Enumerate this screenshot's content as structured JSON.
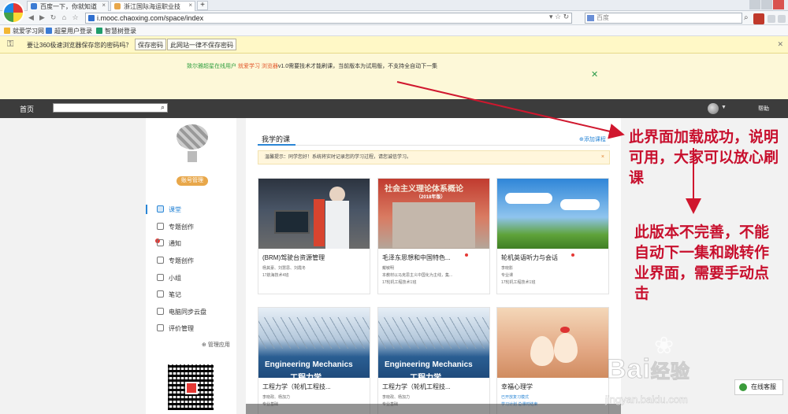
{
  "browser": {
    "tabs": [
      {
        "label": "百度一下，你就知道"
      },
      {
        "label": "浙江国际海运职业技"
      }
    ],
    "url": "i.mooc.chaoxing.com/space/index",
    "search_placeholder": "百度"
  },
  "bookmarks": [
    "就爱学习网",
    "超星用户登录",
    "智慧树登录"
  ],
  "password_bar": {
    "question": "要让360极速浏览器保存您的密码吗？",
    "save_label": "保存密码",
    "never_label": "此网站一律不保存密码"
  },
  "notice": {
    "part1": "致尔雅超星在线用户",
    "part2": "就爱学习 浏览器",
    "part3": "v1.0需要技术才能刷课，当前版本为试用版，不支持全自动下一集"
  },
  "site_header": {
    "home_label": "首页",
    "help_label": "帮助"
  },
  "sidebar": {
    "manage_label": "账号管理",
    "items": [
      {
        "label": "课堂"
      },
      {
        "label": "专题创作"
      },
      {
        "label": "通知"
      },
      {
        "label": "专题创作"
      },
      {
        "label": "小组"
      },
      {
        "label": "笔记"
      },
      {
        "label": "电脑同步云盘"
      },
      {
        "label": "评价管理"
      }
    ],
    "manage_apps_label": "管理应用"
  },
  "main": {
    "tab_label": "我学的课",
    "add_course_label": "添加课程",
    "tip": "温馨提示：同学您好！系统将实时记录您的学习过程，请您诚信学习。",
    "courses": [
      {
        "title": "(BRM)驾驶台资源管理",
        "teacher": "杨其豪、刘慧思、刘霞冬",
        "class": "17航海技术4班"
      },
      {
        "title": "毛泽东思想和中国特色...",
        "teacher": "戴敏明",
        "class": "本教材以马克思主义中国化为主线，集...",
        "class2": "17轮机工程技术1班",
        "thumb_text": "社会主义理论体系概论",
        "thumb_sub": "（2018年版）"
      },
      {
        "title": "轮机英语听力与会话",
        "teacher": "李晓影",
        "class": "专业课",
        "class2": "17轮机工程技术1班"
      },
      {
        "title": "工程力学（轮机工程技...",
        "teacher": "李晓政、杨加力",
        "class": "专业基础",
        "thumb_text": "Engineering Mechanics",
        "thumb_sub": "工程力学"
      },
      {
        "title": "工程力学（轮机工程技...",
        "teacher": "李晓政、杨加力",
        "class": "专业基础",
        "thumb_text": "Engineering Mechanics",
        "thumb_sub": "工程力学"
      },
      {
        "title": "幸福心理学",
        "teacher": "已开放复习模式",
        "class": "学习计划 总课时结束"
      }
    ]
  },
  "annotations": {
    "top": [
      "此界面加载成功，说明",
      "可用，大家可以放心刷",
      "课"
    ],
    "bottom": [
      "此版本不完善，不能",
      "自动下一集和跳转作",
      "业界面，需要手动点",
      "击"
    ]
  },
  "watermark": {
    "brand": "Bai",
    "brand2": "经验",
    "url": "jingyan.baidu.com"
  },
  "service_label": "在线客服",
  "colors": {
    "accent": "#2a86d6",
    "annotation": "#c8102e",
    "header_bg": "#3c3c3c",
    "notice_bg": "#fdf8d8"
  }
}
